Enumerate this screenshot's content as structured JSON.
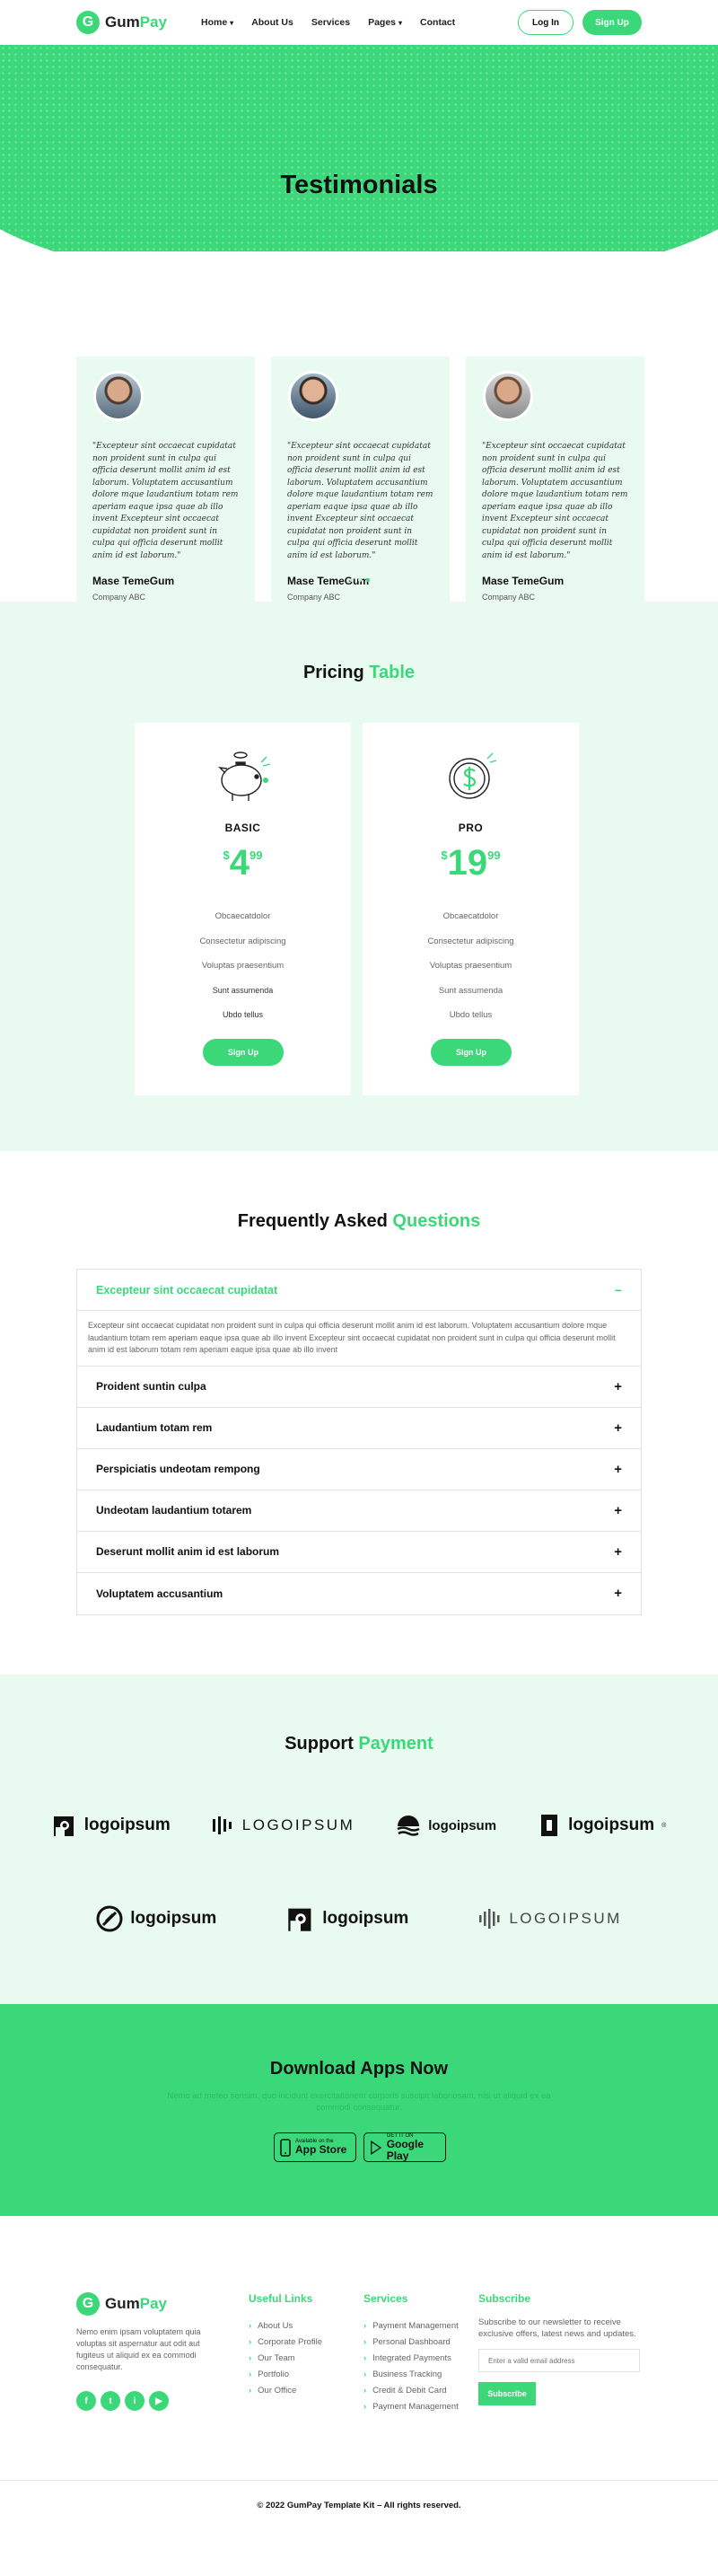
{
  "colors": {
    "accent": "#3bd87a",
    "light_bg": "#e9faf0"
  },
  "header": {
    "logo_mark": "G",
    "logo_word_1": "Gum",
    "logo_word_2": "Pay",
    "nav": [
      {
        "label": "Home",
        "has_caret": true
      },
      {
        "label": "About Us",
        "has_caret": false
      },
      {
        "label": "Services",
        "has_caret": false
      },
      {
        "label": "Pages",
        "has_caret": true
      },
      {
        "label": "Contact",
        "has_caret": false
      }
    ],
    "login_label": "Log In",
    "signup_label": "Sign Up"
  },
  "hero": {
    "title": "Testimonials"
  },
  "testimonials": [
    {
      "quote": "\"Excepteur sint occaecat cupidatat non proident sunt in culpa qui officia deserunt mollit anim id est laborum. Voluptatem accusantium dolore mque laudantium totam rem aperiam eaque ipsa quae ab illo invent Excepteur sint occaecat cupidatat non proident sunt in culpa qui officia deserunt mollit anim id est laborum.\"",
      "name": "Mase TemeGum",
      "company": "Company ABC"
    },
    {
      "quote": "\"Excepteur sint occaecat cupidatat non proident sunt in culpa qui officia deserunt mollit anim id est laborum. Voluptatem accusantium dolore mque laudantium totam rem aperiam eaque ipsa quae ab illo invent Excepteur sint occaecat cupidatat non proident sunt in culpa qui officia deserunt mollit anim id est laborum.\"",
      "name": "Mase TemeGum",
      "company": "Company ABC"
    },
    {
      "quote": "\"Excepteur sint occaecat cupidatat non proident sunt in culpa qui officia deserunt mollit anim id est laborum. Voluptatem accusantium dolore mque laudantium totam rem aperiam eaque ipsa quae ab illo invent Excepteur sint occaecat cupidatat non proident sunt in culpa qui officia deserunt mollit anim id est laborum.\"",
      "name": "Mase TemeGum",
      "company": "Company ABC"
    }
  ],
  "pricing": {
    "title_1": "Pricing",
    "title_2": "Table",
    "plans": [
      {
        "name": "BASIC",
        "currency": "$",
        "price": "4",
        "cents": "99",
        "icon": "piggy-bank-icon",
        "features": [
          "Obcaecatdolor",
          "Consectetur adipiscing",
          "Voluptas praesentium",
          "Sunt assumenda",
          "Ubdo tellus"
        ],
        "button": "Sign Up"
      },
      {
        "name": "PRO",
        "currency": "$",
        "price": "19",
        "cents": "99",
        "icon": "dollar-coin-icon",
        "features": [
          "Obcaecatdolor",
          "Consectetur adipiscing",
          "Voluptas praesentium",
          "Sunt assumenda",
          "Ubdo tellus"
        ],
        "button": "Sign Up"
      }
    ]
  },
  "faq": {
    "title_1": "Frequently Asked",
    "title_2": "Questions",
    "open_question": "Excepteur sint occaecat cupidatat",
    "open_answer": "Excepteur sint occaecat cupidatat non proident sunt in culpa qui officia deserunt mollit anim id est laborum. Voluptatem accusantium dolore mque laudantium totam rem aperiam eaque ipsa quae ab illo invent Excepteur sint occaecat cupidatat non proident sunt in culpa qui officia deserunt mollit anim id est laborum totam rem aperiam eaque ipsa quae ab illo invent",
    "collapse_icon": "−",
    "expand_icon": "+",
    "items": [
      "Proident suntin culpa",
      "Laudantium totam rem",
      "Perspiciatis undeotam rempong",
      "Undeotam laudantium totarem",
      "Deserunt mollit anim id est laborum",
      "Voluptatem accusantium"
    ]
  },
  "support": {
    "title_1": "Support",
    "title_2": "Payment",
    "row1": [
      "logoipsum",
      "LOGOIPSUM",
      "logoipsum",
      "logoipsum"
    ],
    "row2": [
      "logoipsum",
      "logoipsum",
      "LOGOIPSUM"
    ],
    "registered_mark": "®"
  },
  "download": {
    "title": "Download Apps Now",
    "text": "Nemo ad meteo sensim, quo incidunt exercitationem corporis suscipit laboriosam, nisi ut aliquid ex ea commodi consequatur.",
    "app_store_small": "Available on the",
    "app_store_big": "App Store",
    "google_small": "GET IT ON",
    "google_big": "Google Play"
  },
  "footer": {
    "logo_mark": "G",
    "logo_word_1": "Gum",
    "logo_word_2": "Pay",
    "description": "Nemo enim ipsam voluptatem quia voluptas sit aspernatur aut odit aut fugiteus ut aliquid ex ea commodi consequatur.",
    "socials": [
      "f",
      "t",
      "i",
      "▶"
    ],
    "useful_links_title": "Useful Links",
    "useful_links": [
      "About Us",
      "Corporate Profile",
      "Our Team",
      "Portfolio",
      "Our Office"
    ],
    "services_title": "Services",
    "services": [
      "Payment Management",
      "Personal Dashboard",
      "Integrated Payments",
      "Business Tracking",
      "Credit & Debit Card",
      "Payment Management"
    ],
    "subscribe_title": "Subscribe",
    "subscribe_text": "Subscribe to our newsletter to receive exclusive offers, latest news and updates.",
    "email_placeholder": "Enter a valid email address",
    "subscribe_button": "Subscribe",
    "copyright": "© 2022 GumPay Template Kit – All rights reserved."
  }
}
